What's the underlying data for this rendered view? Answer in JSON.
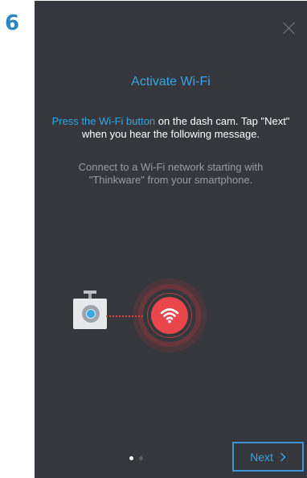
{
  "step_number": "6",
  "screen": {
    "title": "Activate Wi-Fi",
    "instruction_highlight": "Press the Wi-Fi button",
    "instruction_rest": " on the dash cam. Tap \"Next\" when you hear the following message.",
    "voice_message": "Connect to a Wi-Fi network starting with \"Thinkware\" from your smartphone.",
    "next_label": "Next",
    "close_icon": "close-icon",
    "pager": {
      "total": 2,
      "active": 1
    }
  },
  "colors": {
    "accent": "#37a5e4",
    "background": "#35373c",
    "wifi_red": "#e9464b",
    "step_blue": "#2f86c4"
  }
}
